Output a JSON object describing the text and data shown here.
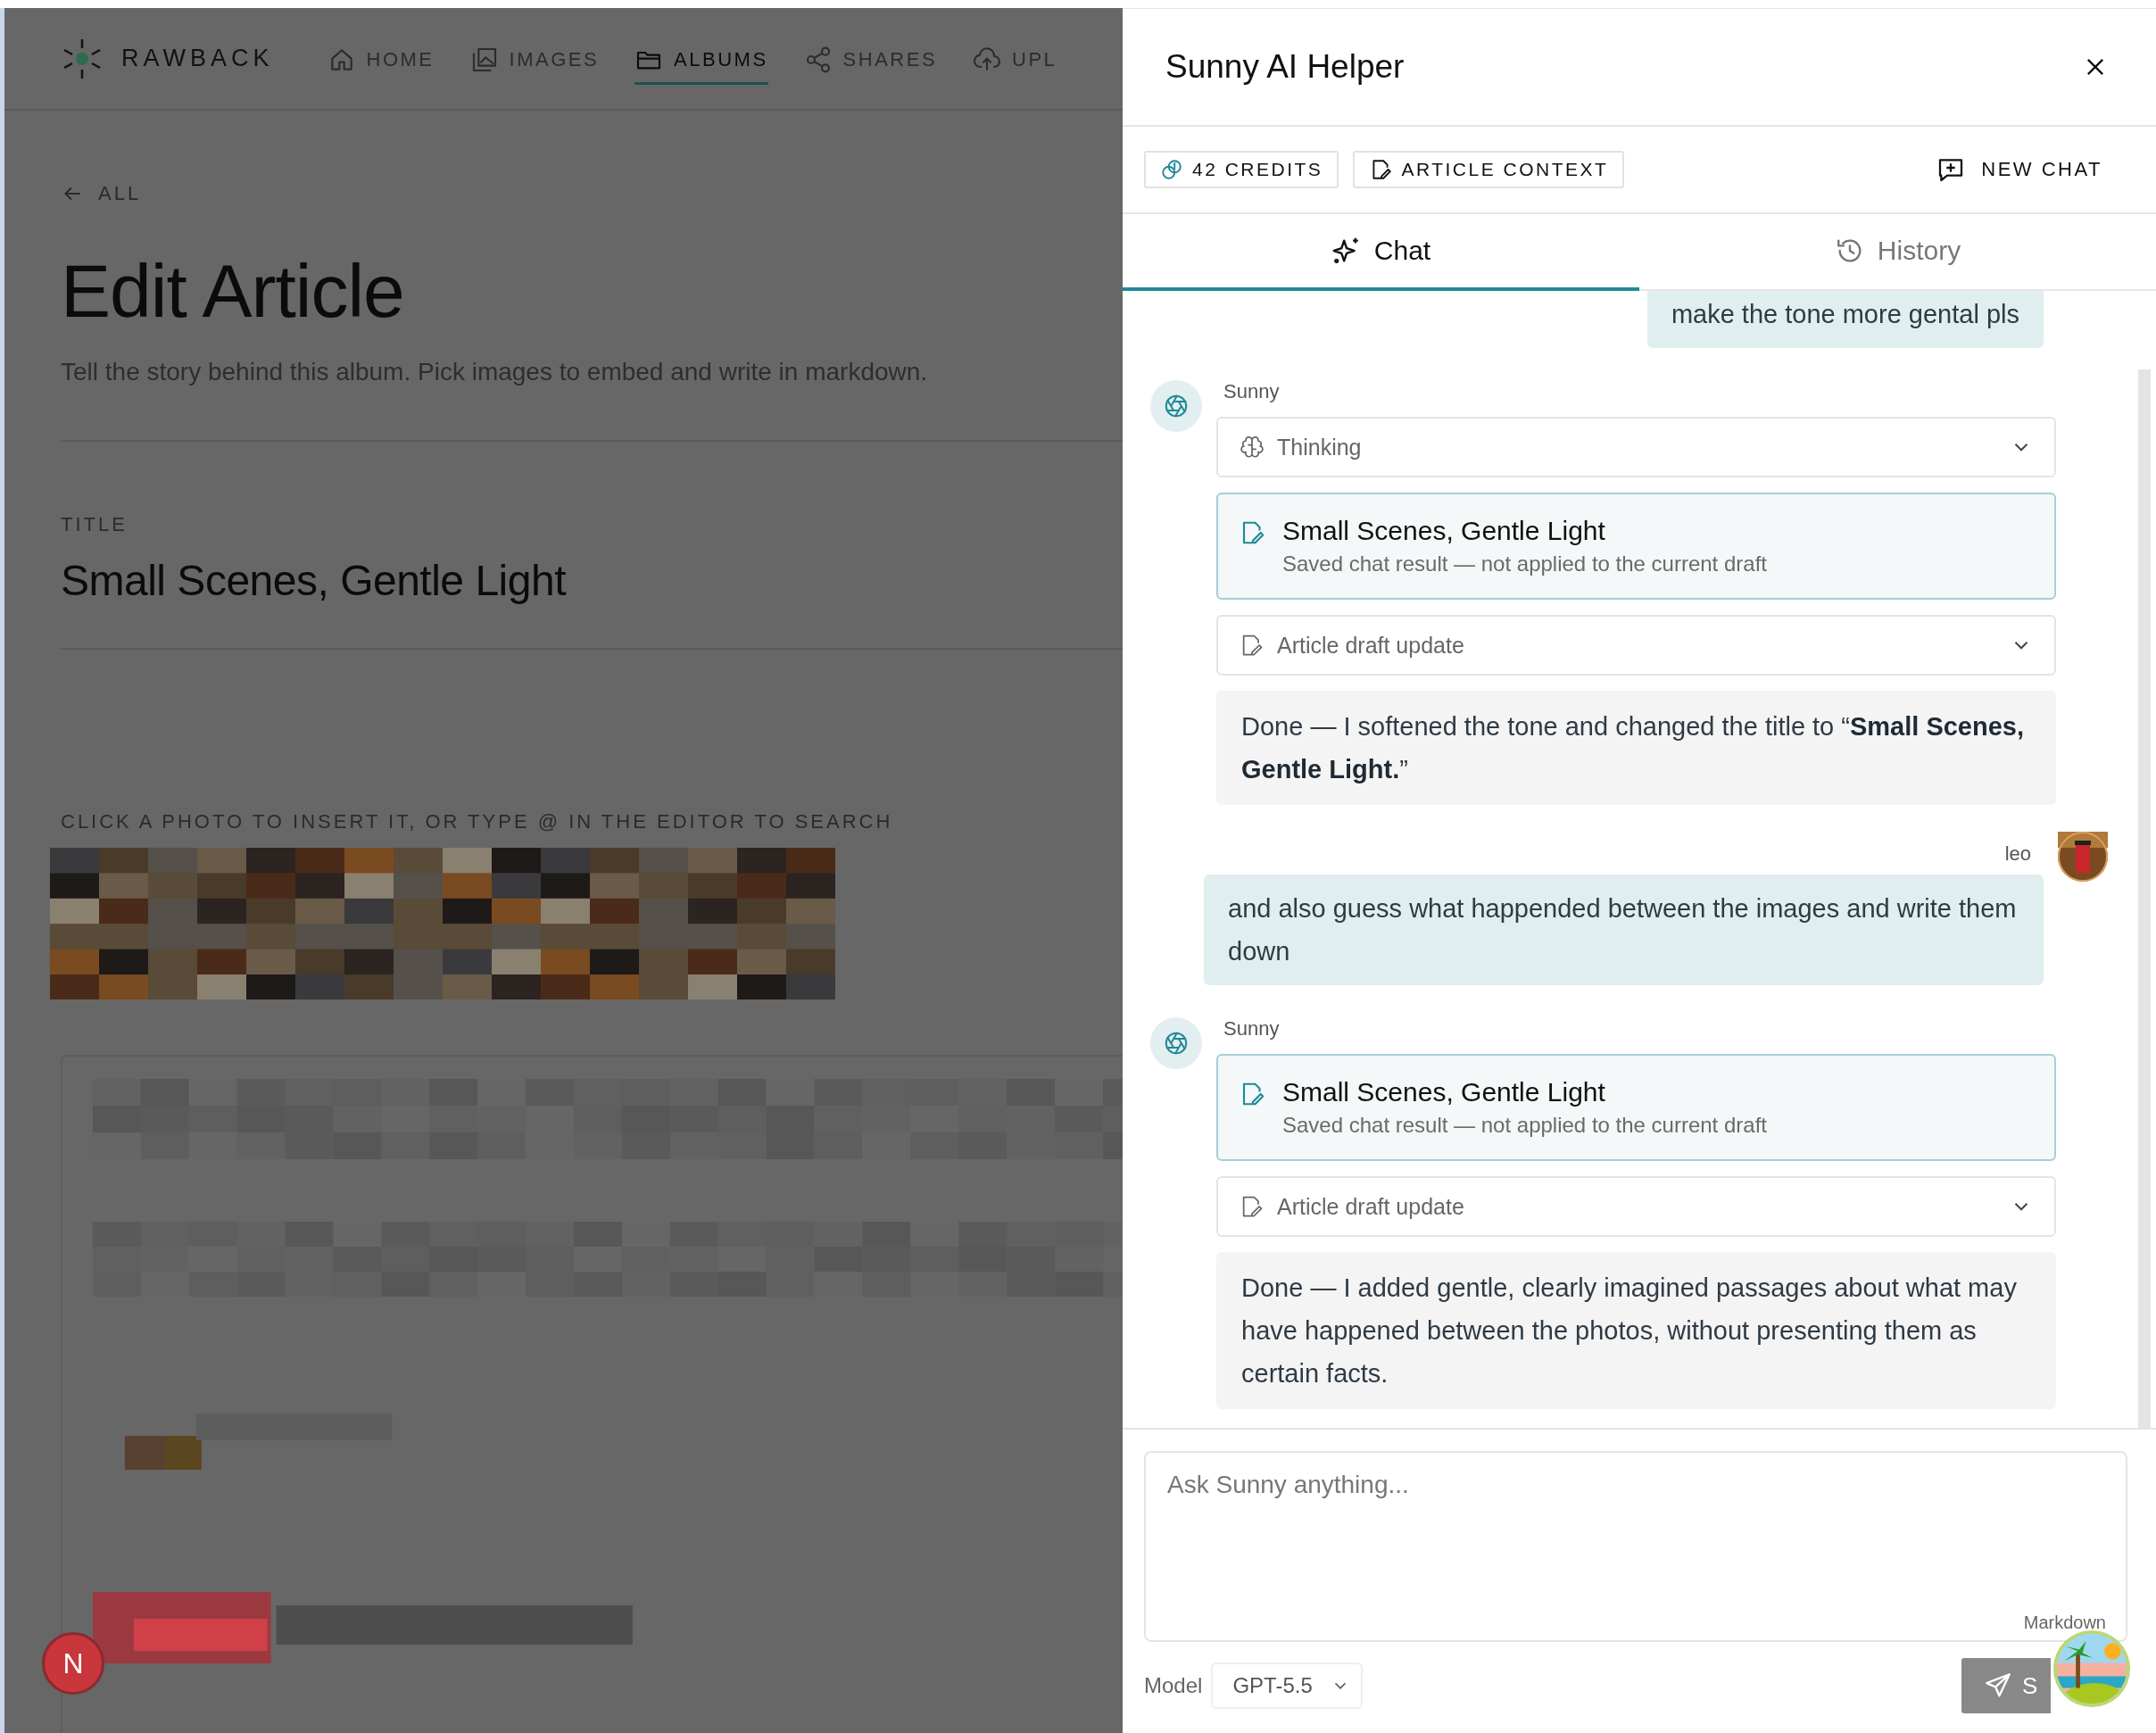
{
  "nav": {
    "brand": "RAWBACK",
    "items": [
      {
        "kind": "home",
        "label": "HOME",
        "selected": false
      },
      {
        "kind": "images",
        "label": "IMAGES",
        "selected": false
      },
      {
        "kind": "albums",
        "label": "ALBUMS",
        "selected": true
      },
      {
        "kind": "shares",
        "label": "SHARES",
        "selected": false
      },
      {
        "kind": "upload",
        "label": "UPL",
        "selected": false
      }
    ]
  },
  "page": {
    "back": "ALL",
    "title": "Edit Article",
    "subtitle": "Tell the story behind this album. Pick images to embed and write in markdown.",
    "field_label": "TITLE",
    "field_value": "Small Scenes, Gentle Light",
    "photos_hint": "CLICK A PHOTO TO INSERT IT, OR TYPE @ IN THE EDITOR TO SEARCH"
  },
  "floating_avatar": {
    "initial": "N"
  },
  "panel": {
    "title": "Sunny AI Helper",
    "credits": "42 CREDITS",
    "context": "ARTICLE CONTEXT",
    "new_chat": "NEW CHAT",
    "tabs": [
      {
        "kind": "chat",
        "label": "Chat",
        "selected": true
      },
      {
        "kind": "history",
        "label": "History",
        "selected": false
      }
    ],
    "messages": [
      {
        "kind": "user",
        "text": "make the tone more gental pls"
      },
      {
        "kind": "assistant",
        "sender": "Sunny",
        "blocks": [
          {
            "kind": "thinking",
            "label": "Thinking"
          },
          {
            "kind": "result",
            "title": "Small Scenes, Gentle Light",
            "note": "Saved chat result — not applied to the current draft"
          },
          {
            "kind": "draft_update",
            "label": "Article draft update"
          },
          {
            "kind": "reply",
            "text": "Done — I softened the tone and changed the title to “**Small Scenes, Gentle Light.**”"
          }
        ]
      },
      {
        "kind": "user",
        "sender": "leo",
        "text": "and also guess what happended between the images and write them down"
      },
      {
        "kind": "assistant",
        "sender": "Sunny",
        "blocks": [
          {
            "kind": "result",
            "title": "Small Scenes, Gentle Light",
            "note": "Saved chat result — not applied to the current draft"
          },
          {
            "kind": "draft_update",
            "label": "Article draft update"
          },
          {
            "kind": "reply",
            "text": "Done — I added gentle, clearly imagined passages about what may have happened between the photos, without presenting them as certain facts."
          }
        ]
      }
    ],
    "composer": {
      "placeholder": "Ask Sunny anything...",
      "hint": "Markdown",
      "model_label": "Model",
      "model": "GPT-5.5",
      "send": "S"
    }
  }
}
